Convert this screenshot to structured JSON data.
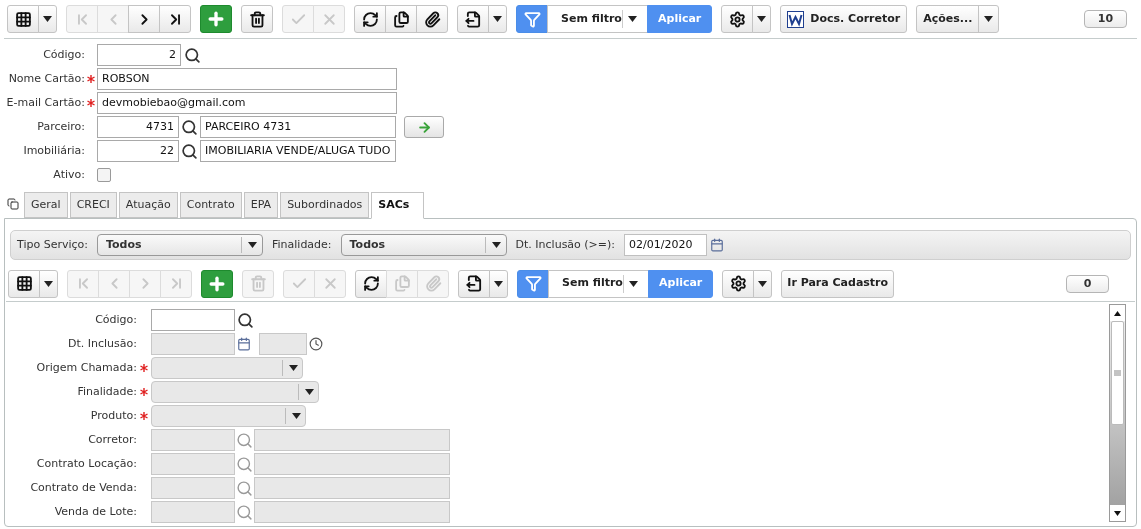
{
  "toolbar": {
    "groups": [
      [
        {
          "kind": "grid",
          "disabled": false
        },
        {
          "kind": "caret",
          "disabled": false
        }
      ],
      [
        {
          "kind": "first",
          "disabled": true
        },
        {
          "kind": "prev",
          "disabled": true
        },
        {
          "kind": "next",
          "disabled": false
        },
        {
          "kind": "last",
          "disabled": false
        }
      ],
      [
        {
          "kind": "add",
          "disabled": false
        }
      ],
      [
        {
          "kind": "delete",
          "disabled": false
        }
      ],
      [
        {
          "kind": "confirm",
          "disabled": true
        },
        {
          "kind": "cancel",
          "disabled": true
        }
      ],
      [
        {
          "kind": "refresh",
          "disabled": false
        },
        {
          "kind": "copy",
          "disabled": false
        },
        {
          "kind": "attach",
          "disabled": false
        }
      ],
      [
        {
          "kind": "export",
          "disabled": false
        },
        {
          "kind": "caret",
          "disabled": false
        }
      ],
      [
        {
          "kind": "filter",
          "disabled": false
        },
        {
          "kind": "filter-select",
          "text": "Sem filtro",
          "disabled": false
        },
        {
          "kind": "apply",
          "text": "Aplicar",
          "disabled": false
        }
      ],
      [
        {
          "kind": "gear",
          "disabled": false
        },
        {
          "kind": "caret",
          "disabled": false
        }
      ],
      [
        {
          "kind": "word-button",
          "text": "Docs. Corretor",
          "disabled": false
        }
      ],
      [
        {
          "kind": "menu-button",
          "text": "Ações...",
          "disabled": false
        }
      ]
    ],
    "count": "10"
  },
  "form": [
    {
      "kind": "code",
      "label": "Código:",
      "required": false,
      "value": "2"
    },
    {
      "kind": "text",
      "label": "Nome Cartão:",
      "required": true,
      "value": "ROBSON"
    },
    {
      "kind": "text",
      "label": "E-mail Cartão:",
      "required": true,
      "value": "devmobiebao@gmail.com"
    },
    {
      "kind": "lookup",
      "label": "Parceiro:",
      "required": false,
      "value": "4731",
      "description": "PARCEIRO 4731",
      "go_button": true
    },
    {
      "kind": "lookup",
      "label": "Imobiliária:",
      "required": false,
      "value": "22",
      "description": "IMOBILIARIA VENDE/ALUGA TUDO",
      "go_button": false
    },
    {
      "kind": "checkbox",
      "label": "Ativo:",
      "required": false,
      "checked": false
    }
  ],
  "tabs": [
    {
      "label": "Geral",
      "selected": false
    },
    {
      "label": "CRECI",
      "selected": false
    },
    {
      "label": "Atuação",
      "selected": false
    },
    {
      "label": "Contrato",
      "selected": false
    },
    {
      "label": "EPA",
      "selected": false
    },
    {
      "label": "Subordinados",
      "selected": false
    },
    {
      "label": "SACs",
      "selected": true
    }
  ],
  "filters": [
    {
      "kind": "select",
      "label": "Tipo Serviço:",
      "value": "Todos"
    },
    {
      "kind": "select",
      "label": "Finalidade:",
      "value": "Todos"
    },
    {
      "kind": "date",
      "label": "Dt. Inclusão (>=):",
      "value": "02/01/2020"
    }
  ],
  "sub_toolbar": {
    "groups": [
      [
        {
          "kind": "grid",
          "disabled": false
        },
        {
          "kind": "caret",
          "disabled": false
        }
      ],
      [
        {
          "kind": "first",
          "disabled": true
        },
        {
          "kind": "prev",
          "disabled": true
        },
        {
          "kind": "next",
          "disabled": true
        },
        {
          "kind": "last",
          "disabled": true
        }
      ],
      [
        {
          "kind": "add",
          "disabled": false
        }
      ],
      [
        {
          "kind": "delete",
          "disabled": true
        }
      ],
      [
        {
          "kind": "confirm",
          "disabled": true
        },
        {
          "kind": "cancel",
          "disabled": true
        }
      ],
      [
        {
          "kind": "refresh",
          "disabled": false
        },
        {
          "kind": "copy",
          "disabled": true
        },
        {
          "kind": "attach",
          "disabled": true
        }
      ],
      [
        {
          "kind": "export",
          "disabled": false
        },
        {
          "kind": "caret",
          "disabled": false
        }
      ],
      [
        {
          "kind": "filter",
          "disabled": false
        },
        {
          "kind": "filter-select",
          "text": "Sem filtro",
          "disabled": false
        },
        {
          "kind": "apply",
          "text": "Aplicar",
          "disabled": false
        }
      ],
      [
        {
          "kind": "gear",
          "disabled": false
        },
        {
          "kind": "caret",
          "disabled": false
        }
      ],
      [
        {
          "kind": "text-button",
          "text": "Ir Para Cadastro",
          "disabled": false
        }
      ]
    ],
    "count": "0"
  },
  "sub_form": [
    {
      "kind": "code",
      "label": "Código:",
      "required": false,
      "disabled": false
    },
    {
      "kind": "datetime",
      "label": "Dt. Inclusão:",
      "required": false,
      "disabled": true
    },
    {
      "kind": "select",
      "label": "Origem Chamada:",
      "required": true,
      "disabled": true
    },
    {
      "kind": "select",
      "label": "Finalidade:",
      "required": true,
      "disabled": true
    },
    {
      "kind": "select",
      "label": "Produto:",
      "required": true,
      "disabled": true
    },
    {
      "kind": "lookup",
      "label": "Corretor:",
      "required": false,
      "disabled": true
    },
    {
      "kind": "lookup",
      "label": "Contrato Locação:",
      "required": false,
      "disabled": true
    },
    {
      "kind": "lookup",
      "label": "Contrato de Venda:",
      "required": false,
      "disabled": true
    },
    {
      "kind": "lookup",
      "label": "Venda de Lote:",
      "required": false,
      "disabled": true
    }
  ]
}
